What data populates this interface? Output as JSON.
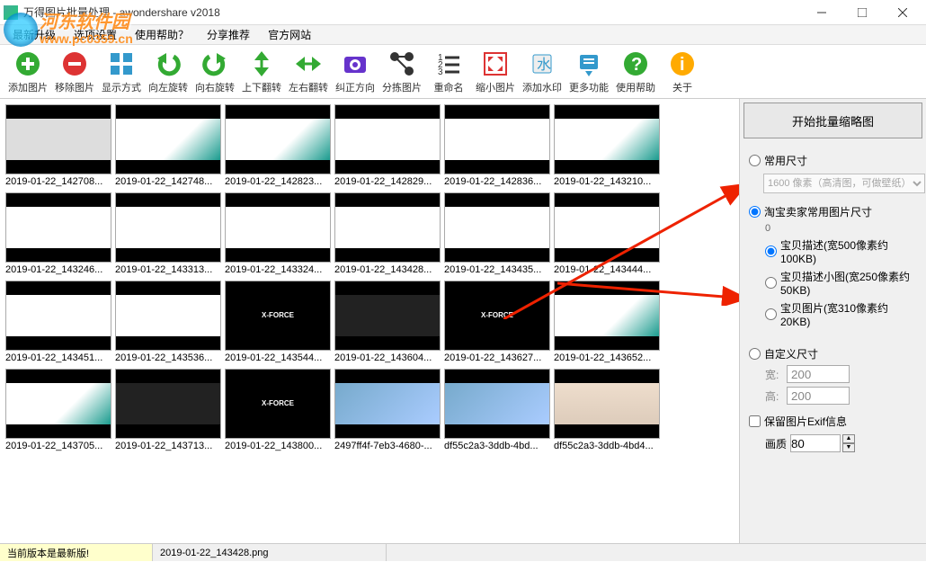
{
  "window": {
    "title": "万得图片批量处理 - awondershare v2018"
  },
  "menu": [
    "最新升级",
    "选项设置",
    "使用帮助？",
    "分享推荐",
    "官方网站"
  ],
  "toolbar": [
    {
      "label": "添加图片",
      "icon": "add",
      "color": "#3a3"
    },
    {
      "label": "移除图片",
      "icon": "remove",
      "color": "#d33"
    },
    {
      "label": "显示方式",
      "icon": "grid",
      "color": "#39c"
    },
    {
      "label": "向左旋转",
      "icon": "rotleft",
      "color": "#3a3"
    },
    {
      "label": "向右旋转",
      "icon": "rotright",
      "color": "#3a3"
    },
    {
      "label": "上下翻转",
      "icon": "flipv",
      "color": "#3a3"
    },
    {
      "label": "左右翻转",
      "icon": "fliph",
      "color": "#3a3"
    },
    {
      "label": "纠正方向",
      "icon": "camera",
      "color": "#63c"
    },
    {
      "label": "分拣图片",
      "icon": "sort",
      "color": "#333"
    },
    {
      "label": "重命名",
      "icon": "list",
      "color": "#333"
    },
    {
      "label": "缩小图片",
      "icon": "shrink",
      "color": "#d33"
    },
    {
      "label": "添加水印",
      "icon": "water",
      "color": "#39c"
    },
    {
      "label": "更多功能",
      "icon": "more",
      "color": "#39c"
    },
    {
      "label": "使用帮助",
      "icon": "help",
      "color": "#3a3"
    },
    {
      "label": "关于",
      "icon": "about",
      "color": "#fa0"
    }
  ],
  "sidepanel": {
    "start_button": "开始批量缩略图",
    "common_size": "常用尺寸",
    "common_select": "1600 像素（高清图，可做壁纸）",
    "taobao_group": "淘宝卖家常用图片尺寸",
    "taobao_count": "0",
    "taobao_opts": [
      "宝贝描述(宽500像素约100KB)",
      "宝贝描述小图(宽250像素约50KB)",
      "宝贝图片(宽310像素约20KB)"
    ],
    "custom_size": "自定义尺寸",
    "width_label": "宽:",
    "width_value": "200",
    "height_label": "高:",
    "height_value": "200",
    "keep_exif": "保留图片Exif信息",
    "quality_label": "画质",
    "quality_value": "80"
  },
  "thumbnails": [
    {
      "name": "2019-01-22_142708...",
      "style": "gray"
    },
    {
      "name": "2019-01-22_142748...",
      "style": "teal"
    },
    {
      "name": "2019-01-22_142823...",
      "style": "teal"
    },
    {
      "name": "2019-01-22_142829...",
      "style": "white"
    },
    {
      "name": "2019-01-22_142836...",
      "style": "white"
    },
    {
      "name": "2019-01-22_143210...",
      "style": "teal"
    },
    {
      "name": "2019-01-22_143246...",
      "style": "white"
    },
    {
      "name": "2019-01-22_143313...",
      "style": "white"
    },
    {
      "name": "2019-01-22_143324...",
      "style": "white"
    },
    {
      "name": "2019-01-22_143428...",
      "style": "white"
    },
    {
      "name": "2019-01-22_143435...",
      "style": "white"
    },
    {
      "name": "2019-01-22_143444...",
      "style": "white"
    },
    {
      "name": "2019-01-22_143451...",
      "style": "white"
    },
    {
      "name": "2019-01-22_143536...",
      "style": "white"
    },
    {
      "name": "2019-01-22_143544...",
      "style": "xforce"
    },
    {
      "name": "2019-01-22_143604...",
      "style": "dark"
    },
    {
      "name": "2019-01-22_143627...",
      "style": "xforce"
    },
    {
      "name": "2019-01-22_143652...",
      "style": "teal"
    },
    {
      "name": "2019-01-22_143705...",
      "style": "teal"
    },
    {
      "name": "2019-01-22_143713...",
      "style": "dark"
    },
    {
      "name": "2019-01-22_143800...",
      "style": "xforce"
    },
    {
      "name": "2497ff4f-7eb3-4680-...",
      "style": "blue"
    },
    {
      "name": "df55c2a3-3ddb-4bd...",
      "style": "blue"
    },
    {
      "name": "df55c2a3-3ddb-4bd4...",
      "style": "photo"
    }
  ],
  "status": {
    "version": "当前版本是最新版!",
    "current_file": "2019-01-22_143428.png"
  },
  "watermark": {
    "text": "河东软件园",
    "url": "www.pc0359.cn"
  }
}
